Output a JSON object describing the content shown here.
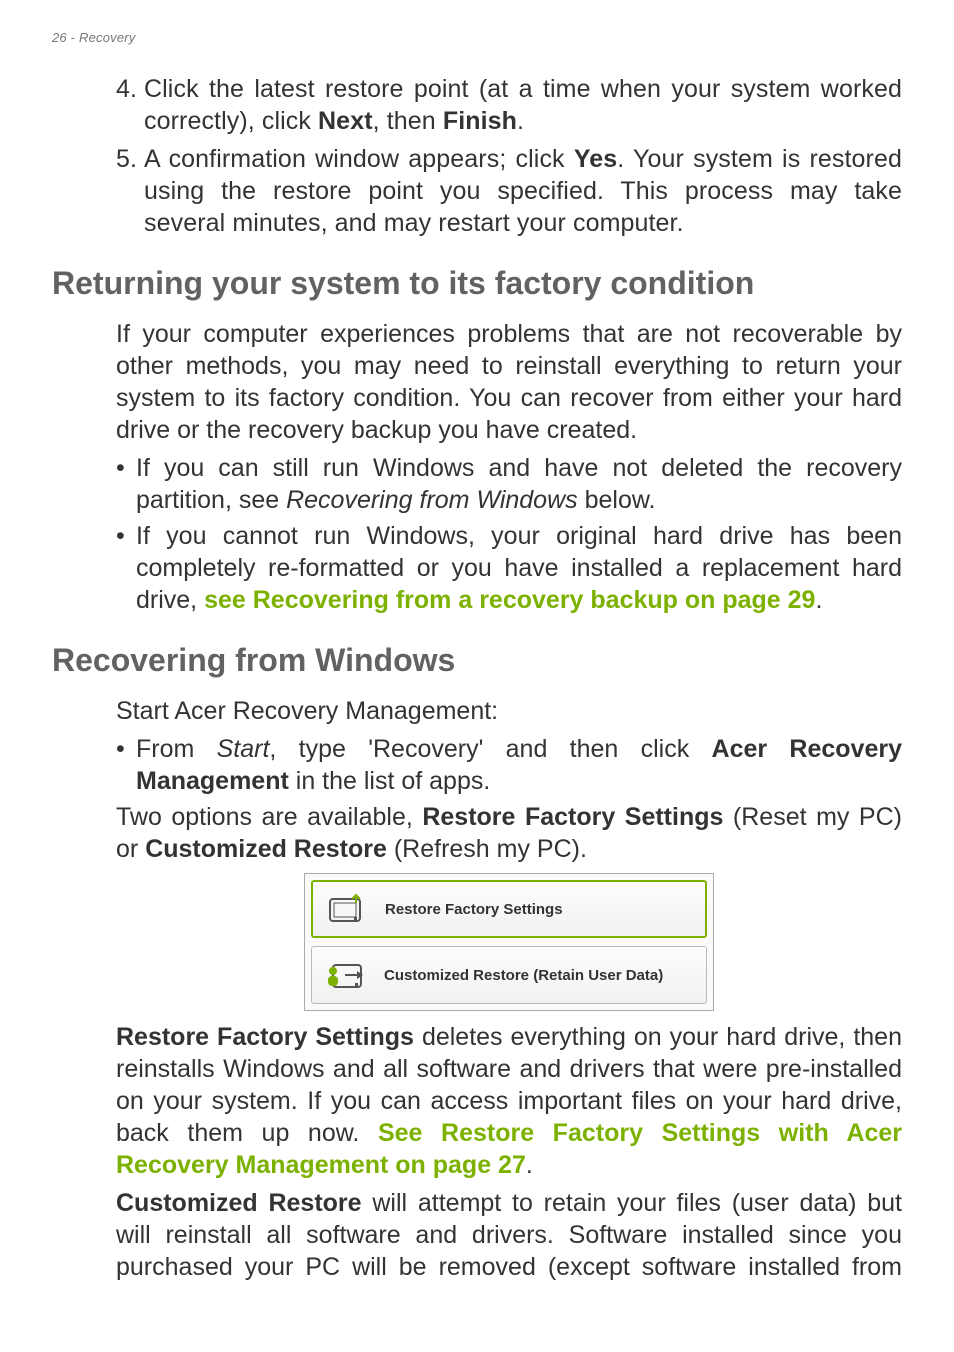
{
  "header": {
    "page_num": "26",
    "section": "Recovery"
  },
  "list1": {
    "item4_num": "4.",
    "item4_a": "Click the latest restore point (at a time when your system worked correctly), click ",
    "item4_b": "Next",
    "item4_c": ", then ",
    "item4_d": "Finish",
    "item4_e": ".",
    "item5_num": "5.",
    "item5_a": "A confirmation window appears; click ",
    "item5_b": "Yes",
    "item5_c": ". Your system is restored using the restore point you specified. This process may take several minutes, and may restart your computer."
  },
  "h2a": "Returning your system to its factory condition",
  "p1": "If your computer experiences problems that are not recoverable by other methods, you may need to reinstall everything to return your system to its factory condition. You can recover from either your hard drive or the recovery backup you have created.",
  "ul1": {
    "a1": "If you can still run Windows and have not deleted the recovery partition, see ",
    "a2": "Recovering from Windows",
    "a3": " below.",
    "b1": "If you cannot run Windows, your original hard drive has been completely re-formatted or you have installed a replacement hard drive, ",
    "b2": "see Recovering from a recovery backup on page 29",
    "b3": "."
  },
  "h2b": "Recovering from Windows",
  "p2": "Start Acer Recovery Management:",
  "ul2": {
    "a1": "From ",
    "a2": "Start",
    "a3": ", type 'Recovery' and then click ",
    "a4": "Acer Recovery Management",
    "a5": " in the list of apps."
  },
  "p3a": "Two options are available, ",
  "p3b": "Restore Factory Settings",
  "p3c": " (Reset my PC) or ",
  "p3d": "Customized Restore",
  "p3e": " (Refresh my PC).",
  "figure": {
    "btn1": "Restore Factory Settings",
    "btn2": "Customized Restore (Retain User Data)"
  },
  "p4a": "Restore Factory Settings",
  "p4b": " deletes everything on your hard drive, then reinstalls Windows and all software and drivers that were pre-installed on your system. If you can access important files on your hard drive, back them up now. ",
  "p4c": "See Restore Factory Settings with Acer Recovery Management on page 27",
  "p4d": ".",
  "p5a": "Customized Restore",
  "p5b": " will attempt to retain your files (user data) but will reinstall all software and drivers. Software installed since you purchased your PC will be removed (except software installed from"
}
